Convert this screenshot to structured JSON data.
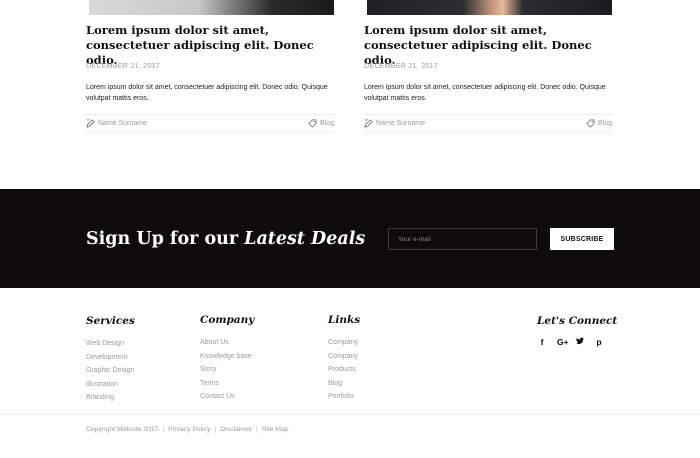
{
  "posts": [
    {
      "title": "Lorem ipsum dolor sit amet, consectetuer adipiscing elit. Donec odio.",
      "date": "December 21, 2017",
      "excerpt": "Lorem ipsum dolor sit amet, consectetuer adipiscing elit. Donec odio. Quisque volutpat mattis eros.",
      "author": "Name Surname",
      "category": "Blog"
    },
    {
      "title": "Lorem ipsum dolor sit amet, consectetuer adipiscing elit. Donec odio.",
      "date": "December 21, 2017",
      "excerpt": "Lorem ipsum dolor sit amet, consectetuer adipiscing elit. Donec odio. Quisque volutpat mattis eros.",
      "author": "Name Surname",
      "category": "Blog"
    }
  ],
  "signup": {
    "heading_prefix": "Sign Up for our",
    "heading_emphasis": "Latest Deals",
    "email_placeholder": "Your e-mail",
    "button_label": "SUBSCRIBE"
  },
  "footer": {
    "services": {
      "title": "Services",
      "items": [
        "Web Design",
        "Development",
        "Graphic Design",
        "Illustration",
        "Branding"
      ]
    },
    "company": {
      "title": "Company",
      "items": [
        "About Us",
        "Knowledge base",
        "Story",
        "Terms",
        "Contact Us"
      ]
    },
    "links": {
      "title": "Links",
      "items": [
        "Company",
        "Company",
        "Products",
        "Blog",
        "Portfolio"
      ]
    },
    "connect": {
      "title": "Let's Connect",
      "icons": [
        {
          "name": "facebook-icon",
          "glyph": "f"
        },
        {
          "name": "google-plus-icon",
          "glyph": "G+"
        },
        {
          "name": "twitter-icon",
          "glyph": "t"
        },
        {
          "name": "pinterest-icon",
          "glyph": "p"
        }
      ]
    },
    "copyright": "Copyright Website 2017",
    "legal_links": [
      "Privacy Policy",
      "Disclaimer",
      "Site Map"
    ]
  },
  "colors": {
    "band_background": "#0d0b0b",
    "muted_text": "#9a9a9a",
    "heading_text": "#111111"
  }
}
